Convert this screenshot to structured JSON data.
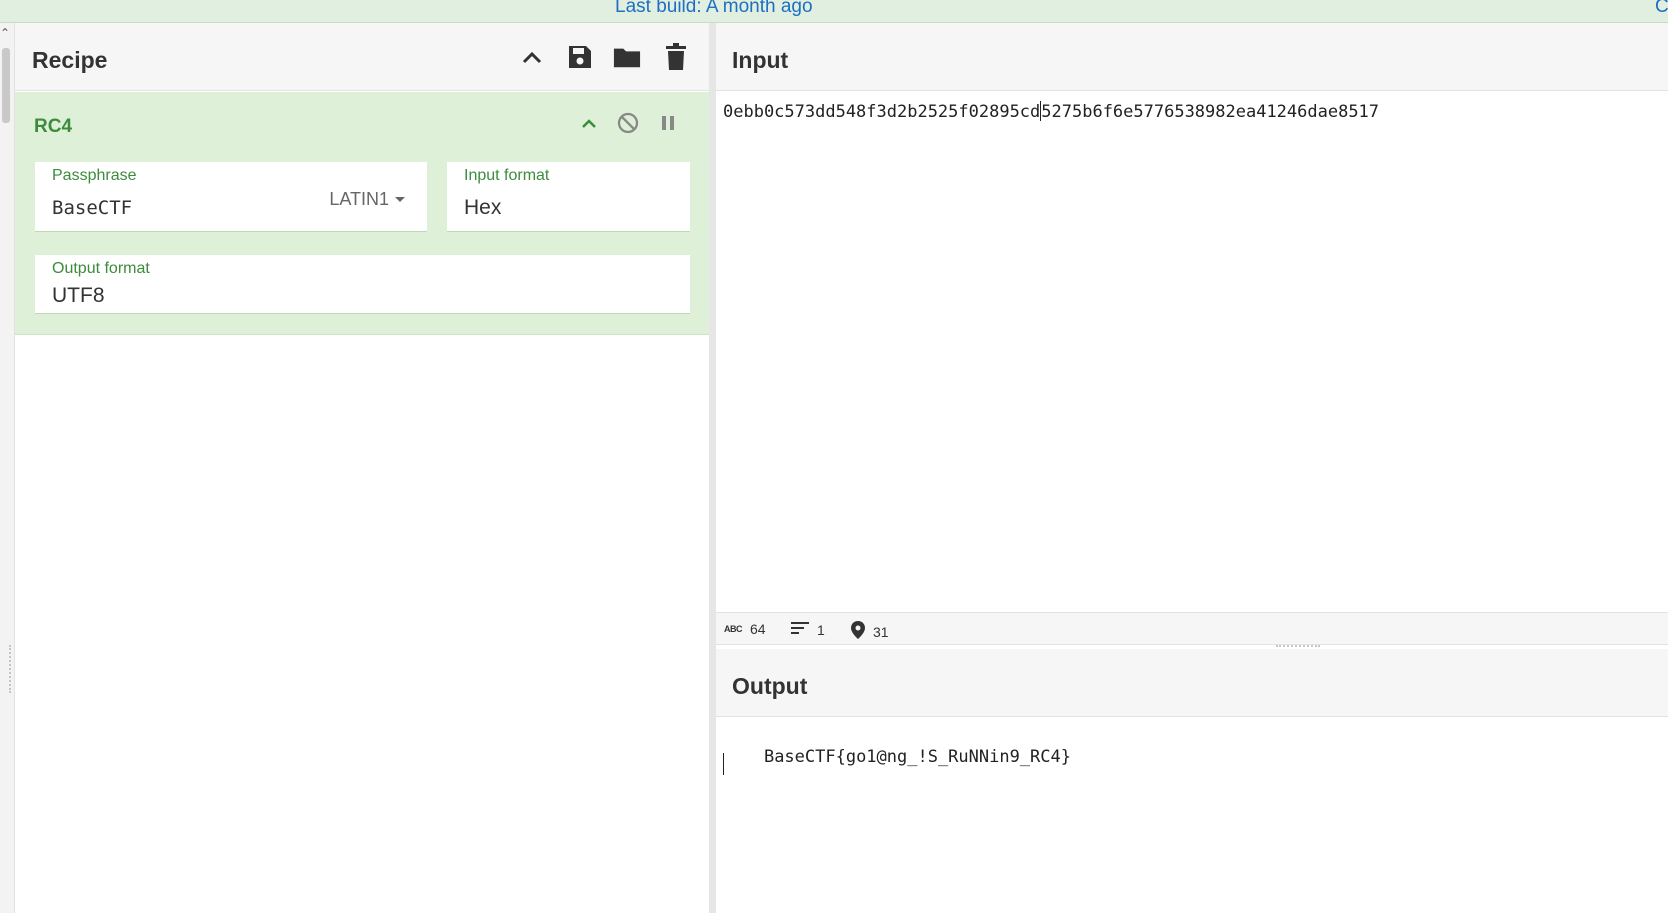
{
  "topbar": {
    "build_text": "Last build: A month ago",
    "edge_text": "C"
  },
  "recipe": {
    "title": "Recipe",
    "icons": [
      "chevron-up-icon",
      "save-icon",
      "folder-icon",
      "trash-icon"
    ],
    "operation": {
      "name": "RC4",
      "passphrase": {
        "label": "Passphrase",
        "value": "BaseCTF",
        "encoding": "LATIN1"
      },
      "input_format": {
        "label": "Input format",
        "value": "Hex"
      },
      "output_format": {
        "label": "Output format",
        "value": "UTF8"
      }
    }
  },
  "input": {
    "title": "Input",
    "text_before_cursor": "0ebb0c573dd548f3d2b2525f02895cd",
    "text_after_cursor": "5275b6f6e5776538982ea41246dae8517",
    "status": {
      "chars": "64",
      "lines": "1",
      "position": "31"
    }
  },
  "output": {
    "title": "Output",
    "text": "BaseCTF{go1@ng_!S_RuNNin9_RC4}"
  },
  "colors": {
    "accent_green": "#3c8c3c",
    "op_background": "#dff0d8",
    "link_blue": "#1e6fc3"
  }
}
